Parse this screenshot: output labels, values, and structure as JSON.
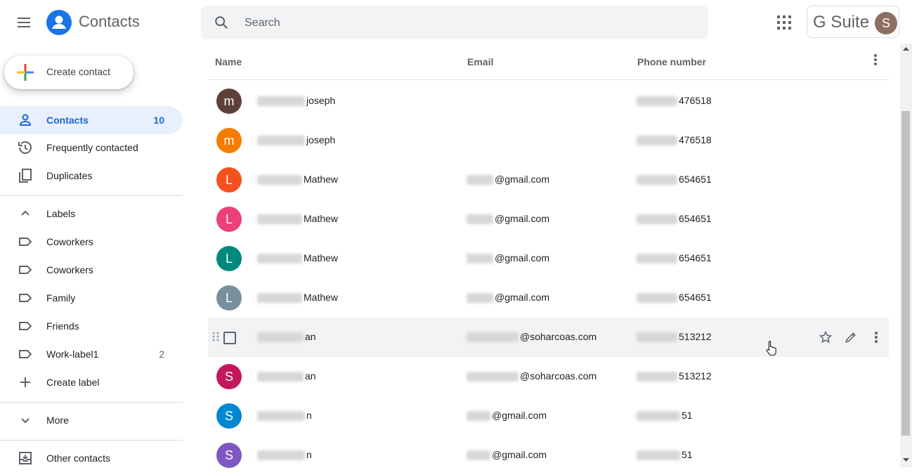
{
  "header": {
    "app_title": "Contacts",
    "search_placeholder": "Search",
    "brand": "G Suite",
    "account_initial": "S"
  },
  "sidebar": {
    "create_label": "Create contact",
    "nav": [
      {
        "label": "Contacts",
        "count": "10",
        "icon": "person-icon",
        "active": true
      },
      {
        "label": "Frequently contacted",
        "count": "",
        "icon": "history-icon"
      },
      {
        "label": "Duplicates",
        "count": "",
        "icon": "duplicates-icon"
      }
    ],
    "labels_header": "Labels",
    "labels": [
      {
        "label": "Coworkers",
        "count": ""
      },
      {
        "label": "Coworkers",
        "count": ""
      },
      {
        "label": "Family",
        "count": ""
      },
      {
        "label": "Friends",
        "count": ""
      },
      {
        "label": "Work-label1",
        "count": "2"
      }
    ],
    "create_label_text": "Create label",
    "more": "More",
    "other_contacts": "Other contacts"
  },
  "table": {
    "columns": {
      "name": "Name",
      "email": "Email",
      "phone": "Phone number"
    },
    "rows": [
      {
        "initial": "m",
        "color": "#5d4037",
        "name_visible": "joseph",
        "email_visible": "",
        "phone_visible": "476518"
      },
      {
        "initial": "m",
        "color": "#f57c00",
        "name_visible": "joseph",
        "email_visible": "",
        "phone_visible": "476518"
      },
      {
        "initial": "L",
        "color": "#f4511e",
        "name_visible": "Mathew",
        "email_visible": "@gmail.com",
        "phone_visible": "654651"
      },
      {
        "initial": "L",
        "color": "#ec407a",
        "name_visible": "Mathew",
        "email_visible": "@gmail.com",
        "phone_visible": "654651"
      },
      {
        "initial": "L",
        "color": "#00897b",
        "name_visible": "Mathew",
        "email_visible": "@gmail.com",
        "phone_visible": "654651"
      },
      {
        "initial": "L",
        "color": "#78909c",
        "name_visible": "Mathew",
        "email_visible": "@gmail.com",
        "phone_visible": "654651"
      },
      {
        "initial": "",
        "color": "",
        "name_visible": "an",
        "email_visible": "@soharcoas.com",
        "phone_visible": "513212",
        "hover": true
      },
      {
        "initial": "S",
        "color": "#c2185b",
        "name_visible": "an",
        "email_visible": "@soharcoas.com",
        "phone_visible": "513212"
      },
      {
        "initial": "S",
        "color": "#0288d1",
        "name_visible": "n",
        "email_visible": "@gmail.com",
        "phone_visible": "51"
      },
      {
        "initial": "S",
        "color": "#7e57c2",
        "name_visible": "n",
        "email_visible": "@gmail.com",
        "phone_visible": "51"
      }
    ]
  },
  "colors": {
    "accent": "#1a73e8",
    "active_bg": "#e8f0fe",
    "active_text": "#1967d2"
  }
}
